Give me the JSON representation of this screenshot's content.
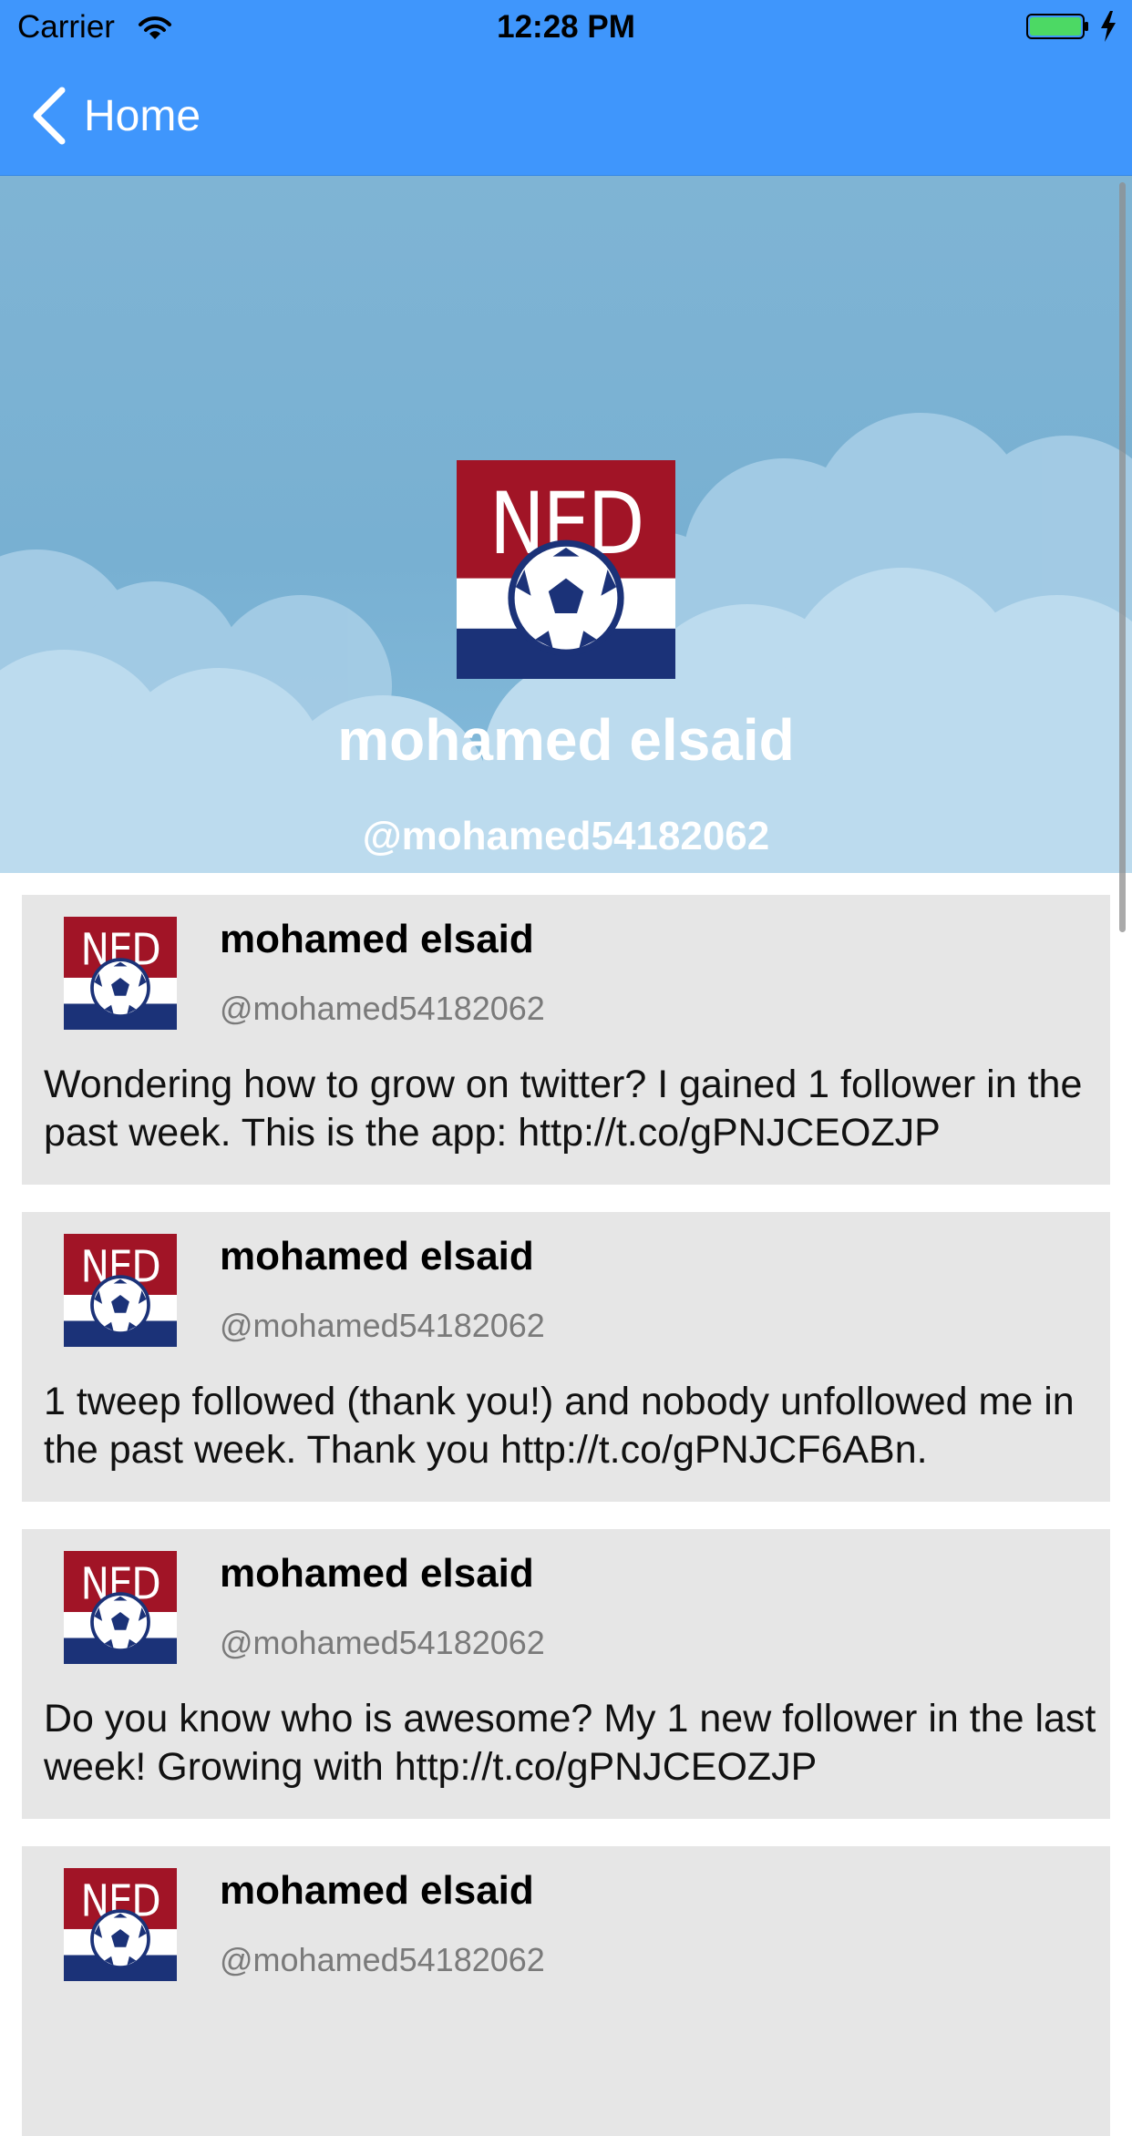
{
  "status_bar": {
    "carrier": "Carrier",
    "time": "12:28 PM"
  },
  "nav": {
    "back_label": "Home"
  },
  "profile": {
    "name": "mohamed elsaid",
    "handle": "@mohamed54182062"
  },
  "tweets": [
    {
      "name": "mohamed elsaid",
      "handle": "@mohamed54182062",
      "text": "Wondering how to grow on twitter? I gained 1 follower in the past week. This is the app: http://t.co/gPNJCEOZJP"
    },
    {
      "name": "mohamed elsaid",
      "handle": "@mohamed54182062",
      "text": "1 tweep followed (thank you!) and nobody unfollowed me in the past week. Thank you http://t.co/gPNJCF6ABn."
    },
    {
      "name": "mohamed elsaid",
      "handle": "@mohamed54182062",
      "text": "Do you know who is awesome? My 1 new follower in the last week! Growing with http://t.co/gPNJCEOZJP"
    },
    {
      "name": "mohamed elsaid",
      "handle": "@mohamed54182062",
      "text": ""
    }
  ],
  "avatar_logo_text": "NED",
  "colors": {
    "nav_blue": "#3f96fc",
    "tweet_bg": "#e6e6e6",
    "flag_red": "#a11426",
    "flag_blue": "#1b3278",
    "battery_green": "#4cd964"
  },
  "icons": [
    "wifi-icon",
    "battery-icon",
    "charging-bolt-icon",
    "back-chevron-icon",
    "avatar-logo"
  ]
}
